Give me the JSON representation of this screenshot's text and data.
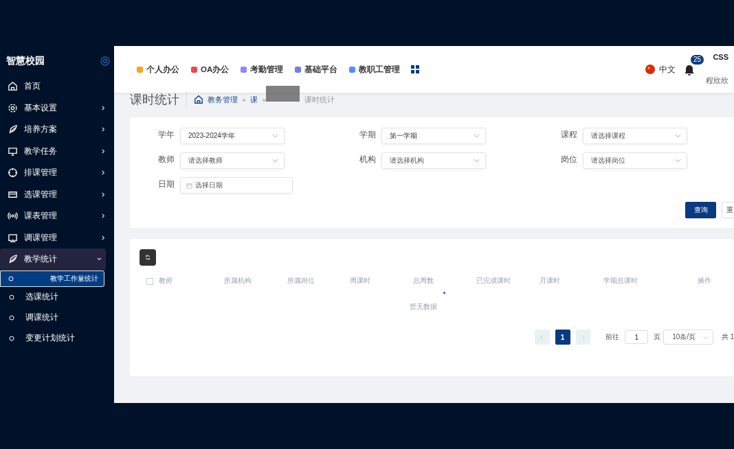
{
  "sidebar": {
    "title": "智慧校园",
    "items": [
      {
        "label": "首页",
        "has_children": false,
        "expanded": false
      },
      {
        "label": "基本设置",
        "has_children": true,
        "expanded": false
      },
      {
        "label": "培养方案",
        "has_children": true,
        "expanded": false
      },
      {
        "label": "教学任务",
        "has_children": true,
        "expanded": false
      },
      {
        "label": "排课管理",
        "has_children": true,
        "expanded": false
      },
      {
        "label": "选课管理",
        "has_children": true,
        "expanded": false
      },
      {
        "label": "课表管理",
        "has_children": true,
        "expanded": false
      },
      {
        "label": "调课管理",
        "has_children": true,
        "expanded": false
      },
      {
        "label": "教学统计",
        "has_children": true,
        "expanded": true,
        "children": [
          {
            "label": "教学工作量统计",
            "selected": true
          },
          {
            "label": "选课统计",
            "selected": false
          },
          {
            "label": "调课统计",
            "selected": false
          },
          {
            "label": "变更计划统计",
            "selected": false
          }
        ]
      }
    ]
  },
  "top_nav": [
    {
      "label": "个人办公",
      "color": "#f5a623"
    },
    {
      "label": "OA办公",
      "color": "#e94b4b"
    },
    {
      "label": "考勤管理",
      "color": "#8c8cf0"
    },
    {
      "label": "基础平台",
      "color": "#7b7be6"
    },
    {
      "label": "教职工管理",
      "color": "#5b8def"
    }
  ],
  "header_right": {
    "language": "中文",
    "notification_count": "25",
    "user_code": "CSS",
    "user_name": "程欣欣"
  },
  "page_title": "课时统计",
  "breadcrumb": [
    {
      "separator": "»",
      "label": "教务管理"
    },
    {
      "separator": "»",
      "label": "课"
    },
    {
      "label": "课时统计"
    }
  ],
  "filters": [
    {
      "label": "学年",
      "value": "2023-2024学年",
      "kind": "select"
    },
    {
      "label": "学期",
      "value": "第一学期",
      "kind": "select"
    },
    {
      "label": "课程",
      "placeholder": "请选择课程",
      "kind": "select"
    },
    {
      "label": "教师",
      "placeholder": "请选择教师",
      "kind": "select"
    },
    {
      "label": "机构",
      "placeholder": "请选择机构",
      "kind": "select"
    },
    {
      "label": "岗位",
      "placeholder": "请选择岗位",
      "kind": "select"
    },
    {
      "label": "日期",
      "placeholder": "选择日期",
      "kind": "date"
    }
  ],
  "buttons": [
    "查询",
    "重"
  ],
  "table": {
    "select_all_checked": false,
    "columns": [
      "教师",
      "所属机构",
      "所属岗位",
      "周课时",
      "总周数",
      "已完成课时",
      "月课时",
      "学期总课时",
      "操作"
    ],
    "empty_text": "暂无数据"
  },
  "pagination": {
    "pages": [
      {
        "label": "1",
        "selected": true
      }
    ],
    "goto_label": "前往",
    "goto_value": "1",
    "page_unit": "页",
    "page_size": "10条/页",
    "total": "共 1"
  }
}
